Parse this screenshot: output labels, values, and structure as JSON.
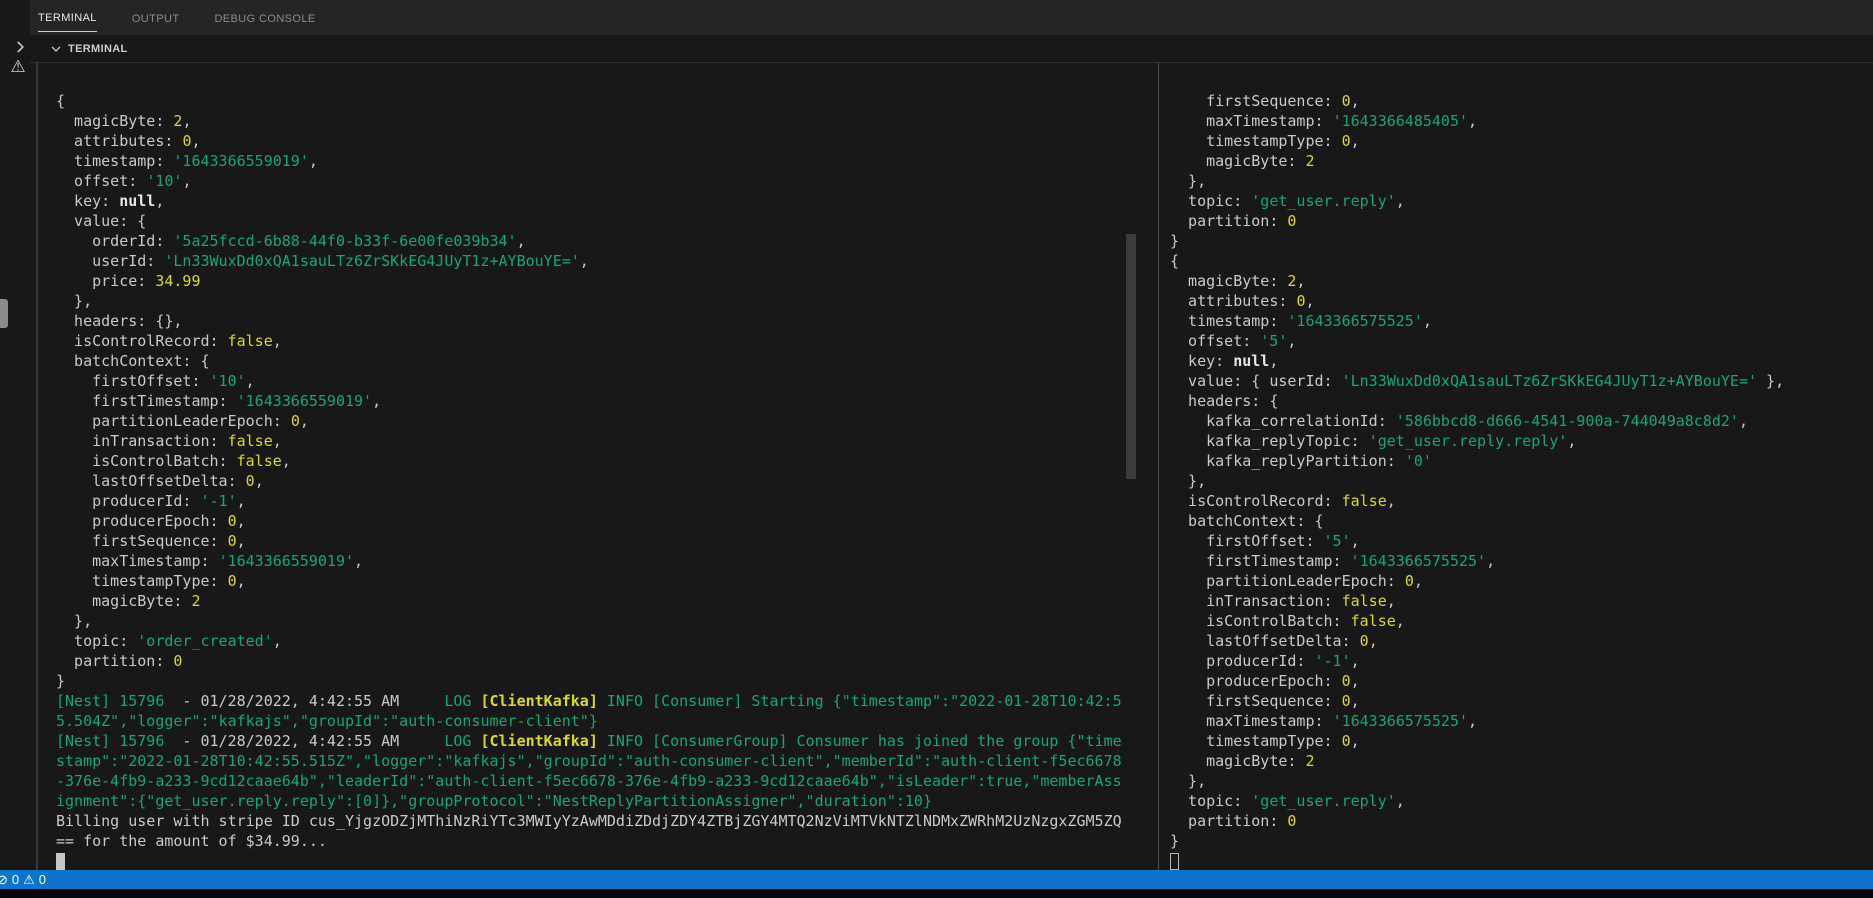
{
  "colors": {
    "bg": "#181818",
    "tabbar_bg": "#252526",
    "divider": "#4a4a4a",
    "white": "#c9c9c9",
    "green": "#15a771",
    "yellow": "#d9da25",
    "boldwhite": "#e8e8e8",
    "status_blue": "#0d74ce",
    "status_text": "#ffffff",
    "inactive_tab": "#8b8b8b"
  },
  "panel": {
    "tabs": [
      {
        "label": "TERMINAL",
        "active": true
      },
      {
        "label": "OUTPUT",
        "active": false
      },
      {
        "label": "DEBUG CONSOLE",
        "active": false
      }
    ],
    "section_label": "TERMINAL"
  },
  "gutter": {
    "warning_icon_glyph": "⚠"
  },
  "status_bar": {
    "error_icon_glyph": "⊘",
    "error_count": "0",
    "warning_icon_glyph": "⚠",
    "warning_count": "0"
  },
  "terminal": {
    "left_lines": [
      [
        [
          "{",
          "w"
        ]
      ],
      [
        [
          "  magicByte: ",
          "w"
        ],
        [
          "2",
          "y"
        ],
        [
          ",",
          "w"
        ]
      ],
      [
        [
          "  attributes: ",
          "w"
        ],
        [
          "0",
          "y"
        ],
        [
          ",",
          "w"
        ]
      ],
      [
        [
          "  timestamp: ",
          "w"
        ],
        [
          "'1643366559019'",
          "g"
        ],
        [
          ",",
          "w"
        ]
      ],
      [
        [
          "  offset: ",
          "w"
        ],
        [
          "'10'",
          "g"
        ],
        [
          ",",
          "w"
        ]
      ],
      [
        [
          "  key: ",
          "w"
        ],
        [
          "null",
          "nb"
        ],
        [
          ",",
          "w"
        ]
      ],
      [
        [
          "  value: {",
          "w"
        ]
      ],
      [
        [
          "    orderId: ",
          "w"
        ],
        [
          "'5a25fccd-6b88-44f0-b33f-6e00fe039b34'",
          "g"
        ],
        [
          ",",
          "w"
        ]
      ],
      [
        [
          "    userId: ",
          "w"
        ],
        [
          "'Ln33WuxDd0xQA1sauLTz6ZrSKkEG4JUyT1z+AYBouYE='",
          "g"
        ],
        [
          ",",
          "w"
        ]
      ],
      [
        [
          "    price: ",
          "w"
        ],
        [
          "34.99",
          "y"
        ]
      ],
      [
        [
          "  },",
          "w"
        ]
      ],
      [
        [
          "  headers: {},",
          "w"
        ]
      ],
      [
        [
          "  isControlRecord: ",
          "w"
        ],
        [
          "false",
          "y"
        ],
        [
          ",",
          "w"
        ]
      ],
      [
        [
          "  batchContext: {",
          "w"
        ]
      ],
      [
        [
          "    firstOffset: ",
          "w"
        ],
        [
          "'10'",
          "g"
        ],
        [
          ",",
          "w"
        ]
      ],
      [
        [
          "    firstTimestamp: ",
          "w"
        ],
        [
          "'1643366559019'",
          "g"
        ],
        [
          ",",
          "w"
        ]
      ],
      [
        [
          "    partitionLeaderEpoch: ",
          "w"
        ],
        [
          "0",
          "y"
        ],
        [
          ",",
          "w"
        ]
      ],
      [
        [
          "    inTransaction: ",
          "w"
        ],
        [
          "false",
          "y"
        ],
        [
          ",",
          "w"
        ]
      ],
      [
        [
          "    isControlBatch: ",
          "w"
        ],
        [
          "false",
          "y"
        ],
        [
          ",",
          "w"
        ]
      ],
      [
        [
          "    lastOffsetDelta: ",
          "w"
        ],
        [
          "0",
          "y"
        ],
        [
          ",",
          "w"
        ]
      ],
      [
        [
          "    producerId: ",
          "w"
        ],
        [
          "'-1'",
          "g"
        ],
        [
          ",",
          "w"
        ]
      ],
      [
        [
          "    producerEpoch: ",
          "w"
        ],
        [
          "0",
          "y"
        ],
        [
          ",",
          "w"
        ]
      ],
      [
        [
          "    firstSequence: ",
          "w"
        ],
        [
          "0",
          "y"
        ],
        [
          ",",
          "w"
        ]
      ],
      [
        [
          "    maxTimestamp: ",
          "w"
        ],
        [
          "'1643366559019'",
          "g"
        ],
        [
          ",",
          "w"
        ]
      ],
      [
        [
          "    timestampType: ",
          "w"
        ],
        [
          "0",
          "y"
        ],
        [
          ",",
          "w"
        ]
      ],
      [
        [
          "    magicByte: ",
          "w"
        ],
        [
          "2",
          "y"
        ]
      ],
      [
        [
          "  },",
          "w"
        ]
      ],
      [
        [
          "  topic: ",
          "w"
        ],
        [
          "'order_created'",
          "g"
        ],
        [
          ",",
          "w"
        ]
      ],
      [
        [
          "  partition: ",
          "w"
        ],
        [
          "0",
          "y"
        ]
      ],
      [
        [
          "}",
          "w"
        ]
      ],
      [
        [
          "[Nest] 15796",
          "g"
        ],
        [
          "  - ",
          "w"
        ],
        [
          "01/28/2022, 4:42:55 AM     ",
          "w"
        ],
        [
          "LOG ",
          "g"
        ],
        [
          "[ClientKafka] ",
          "yb"
        ],
        [
          "INFO [Consumer] Starting {\"timestamp\":\"2022-01-28T10:42:5",
          "g"
        ]
      ],
      [
        [
          "5.504Z\",\"logger\":\"kafkajs\",\"groupId\":\"auth-consumer-client\"}",
          "g"
        ]
      ],
      [
        [
          "[Nest] 15796",
          "g"
        ],
        [
          "  - ",
          "w"
        ],
        [
          "01/28/2022, 4:42:55 AM     ",
          "w"
        ],
        [
          "LOG ",
          "g"
        ],
        [
          "[ClientKafka] ",
          "yb"
        ],
        [
          "INFO [ConsumerGroup] Consumer has joined the group {\"time",
          "g"
        ]
      ],
      [
        [
          "stamp\":\"2022-01-28T10:42:55.515Z\",\"logger\":\"kafkajs\",\"groupId\":\"auth-consumer-client\",\"memberId\":\"auth-client-f5ec6678",
          "g"
        ]
      ],
      [
        [
          "-376e-4fb9-a233-9cd12caae64b\",\"leaderId\":\"auth-client-f5ec6678-376e-4fb9-a233-9cd12caae64b\",\"isLeader\":true,\"memberAss",
          "g"
        ]
      ],
      [
        [
          "ignment\":{\"get_user.reply.reply\":[0]},\"groupProtocol\":\"NestReplyPartitionAssigner\",\"duration\":10}",
          "g"
        ]
      ],
      [
        [
          "Billing user with stripe ID cus_YjgzODZjMThiNzRiYTc3MWIyYzAwMDdiZDdjZDY4ZTBjZGY4MTQ2NzViMTVkNTZlNDMxZWRhM2UzNzgxZGM5ZQ",
          "w"
        ]
      ],
      [
        [
          "== for the amount of $34.99...",
          "w"
        ]
      ],
      [
        [
          "",
          "cursor_block"
        ]
      ]
    ],
    "right_lines": [
      [
        [
          "    firstSequence: ",
          "w"
        ],
        [
          "0",
          "y"
        ],
        [
          ",",
          "w"
        ]
      ],
      [
        [
          "    maxTimestamp: ",
          "w"
        ],
        [
          "'1643366485405'",
          "g"
        ],
        [
          ",",
          "w"
        ]
      ],
      [
        [
          "    timestampType: ",
          "w"
        ],
        [
          "0",
          "y"
        ],
        [
          ",",
          "w"
        ]
      ],
      [
        [
          "    magicByte: ",
          "w"
        ],
        [
          "2",
          "y"
        ]
      ],
      [
        [
          "  },",
          "w"
        ]
      ],
      [
        [
          "  topic: ",
          "w"
        ],
        [
          "'get_user.reply'",
          "g"
        ],
        [
          ",",
          "w"
        ]
      ],
      [
        [
          "  partition: ",
          "w"
        ],
        [
          "0",
          "y"
        ]
      ],
      [
        [
          "}",
          "w"
        ]
      ],
      [
        [
          "{",
          "w"
        ]
      ],
      [
        [
          "  magicByte: ",
          "w"
        ],
        [
          "2",
          "y"
        ],
        [
          ",",
          "w"
        ]
      ],
      [
        [
          "  attributes: ",
          "w"
        ],
        [
          "0",
          "y"
        ],
        [
          ",",
          "w"
        ]
      ],
      [
        [
          "  timestamp: ",
          "w"
        ],
        [
          "'1643366575525'",
          "g"
        ],
        [
          ",",
          "w"
        ]
      ],
      [
        [
          "  offset: ",
          "w"
        ],
        [
          "'5'",
          "g"
        ],
        [
          ",",
          "w"
        ]
      ],
      [
        [
          "  key: ",
          "w"
        ],
        [
          "null",
          "nb"
        ],
        [
          ",",
          "w"
        ]
      ],
      [
        [
          "  value: { userId: ",
          "w"
        ],
        [
          "'Ln33WuxDd0xQA1sauLTz6ZrSKkEG4JUyT1z+AYBouYE='",
          "g"
        ],
        [
          " },",
          "w"
        ]
      ],
      [
        [
          "  headers: {",
          "w"
        ]
      ],
      [
        [
          "    kafka_correlationId: ",
          "w"
        ],
        [
          "'586bbcd8-d666-4541-900a-744049a8c8d2'",
          "g"
        ],
        [
          ",",
          "w"
        ]
      ],
      [
        [
          "    kafka_replyTopic: ",
          "w"
        ],
        [
          "'get_user.reply.reply'",
          "g"
        ],
        [
          ",",
          "w"
        ]
      ],
      [
        [
          "    kafka_replyPartition: ",
          "w"
        ],
        [
          "'0'",
          "g"
        ]
      ],
      [
        [
          "  },",
          "w"
        ]
      ],
      [
        [
          "  isControlRecord: ",
          "w"
        ],
        [
          "false",
          "y"
        ],
        [
          ",",
          "w"
        ]
      ],
      [
        [
          "  batchContext: {",
          "w"
        ]
      ],
      [
        [
          "    firstOffset: ",
          "w"
        ],
        [
          "'5'",
          "g"
        ],
        [
          ",",
          "w"
        ]
      ],
      [
        [
          "    firstTimestamp: ",
          "w"
        ],
        [
          "'1643366575525'",
          "g"
        ],
        [
          ",",
          "w"
        ]
      ],
      [
        [
          "    partitionLeaderEpoch: ",
          "w"
        ],
        [
          "0",
          "y"
        ],
        [
          ",",
          "w"
        ]
      ],
      [
        [
          "    inTransaction: ",
          "w"
        ],
        [
          "false",
          "y"
        ],
        [
          ",",
          "w"
        ]
      ],
      [
        [
          "    isControlBatch: ",
          "w"
        ],
        [
          "false",
          "y"
        ],
        [
          ",",
          "w"
        ]
      ],
      [
        [
          "    lastOffsetDelta: ",
          "w"
        ],
        [
          "0",
          "y"
        ],
        [
          ",",
          "w"
        ]
      ],
      [
        [
          "    producerId: ",
          "w"
        ],
        [
          "'-1'",
          "g"
        ],
        [
          ",",
          "w"
        ]
      ],
      [
        [
          "    producerEpoch: ",
          "w"
        ],
        [
          "0",
          "y"
        ],
        [
          ",",
          "w"
        ]
      ],
      [
        [
          "    firstSequence: ",
          "w"
        ],
        [
          "0",
          "y"
        ],
        [
          ",",
          "w"
        ]
      ],
      [
        [
          "    maxTimestamp: ",
          "w"
        ],
        [
          "'1643366575525'",
          "g"
        ],
        [
          ",",
          "w"
        ]
      ],
      [
        [
          "    timestampType: ",
          "w"
        ],
        [
          "0",
          "y"
        ],
        [
          ",",
          "w"
        ]
      ],
      [
        [
          "    magicByte: ",
          "w"
        ],
        [
          "2",
          "y"
        ]
      ],
      [
        [
          "  },",
          "w"
        ]
      ],
      [
        [
          "  topic: ",
          "w"
        ],
        [
          "'get_user.reply'",
          "g"
        ],
        [
          ",",
          "w"
        ]
      ],
      [
        [
          "  partition: ",
          "w"
        ],
        [
          "0",
          "y"
        ]
      ],
      [
        [
          "}",
          "w"
        ]
      ],
      [
        [
          "",
          "cursor_outline"
        ]
      ]
    ]
  }
}
